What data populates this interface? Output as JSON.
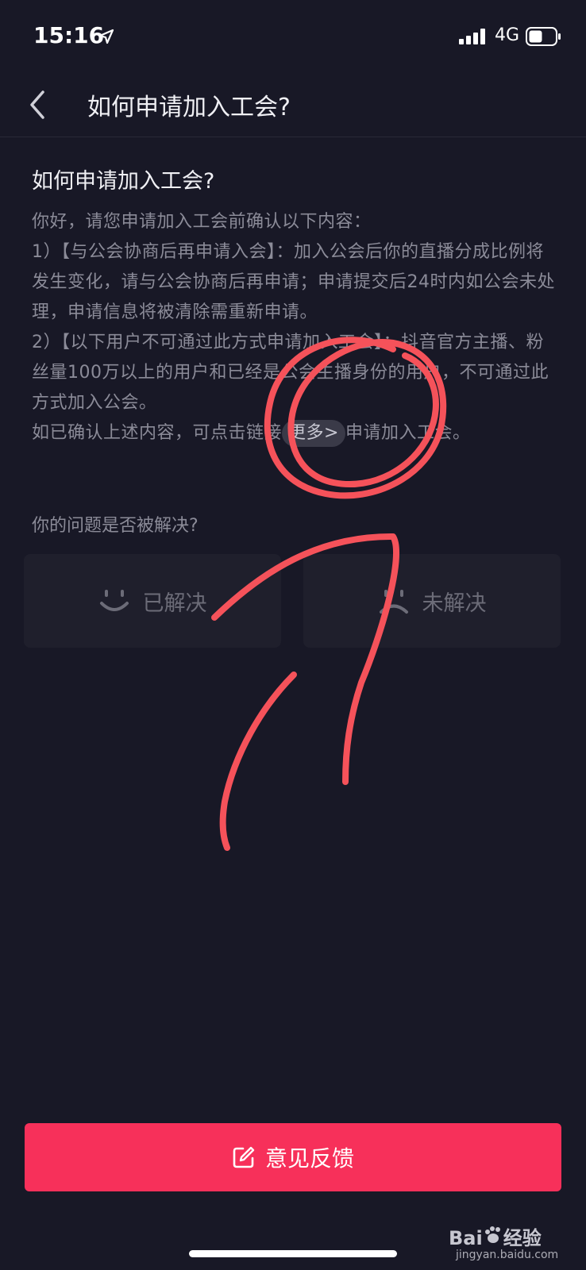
{
  "status_bar": {
    "time": "15:16",
    "network": "4G"
  },
  "nav": {
    "title": "如何申请加入工会?"
  },
  "article": {
    "title": "如何申请加入工会?",
    "intro": "你好，请您申请加入工会前确认以下内容：",
    "item1": "1）【与公会协商后再申请入会】：加入公会后你的直播分成比例将发生变化，请与公会协商后再申请；申请提交后24时内如公会未处理，申请信息将被清除需重新申请。",
    "item2": "2）【以下用户不可通过此方式申请加入工会】：抖音官方主播、粉丝量100万以上的用户和已经是公会主播身份的用户，不可通过此方式加入公会。",
    "confirm_prefix": "如已确认上述内容，可点击链接",
    "more_link": "更多>",
    "confirm_suffix": "申请加入工会。"
  },
  "feedback_question": {
    "label": "你的问题是否被解决?",
    "solved_label": "已解决",
    "unsolved_label": "未解决"
  },
  "feedback_button": {
    "label": "意见反馈"
  },
  "watermark": {
    "brand": "Bai",
    "brand_suffix": "经验",
    "site": "jingyan.baidu.com"
  },
  "colors": {
    "background": "#181826",
    "accent": "#f7305a",
    "annotation": "#f5525a"
  }
}
